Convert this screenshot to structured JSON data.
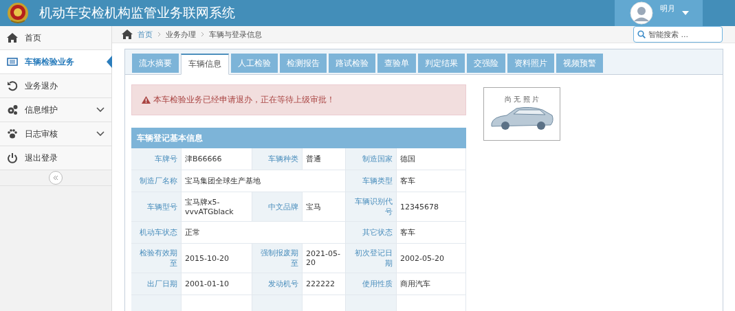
{
  "header": {
    "title": "机动车安检机构监管业务联网系统",
    "user": "明月"
  },
  "sidebar": {
    "items": [
      {
        "label": "首页",
        "selected": false,
        "expandable": false
      },
      {
        "label": "车辆检验业务",
        "selected": true,
        "expandable": false
      },
      {
        "label": "业务退办",
        "selected": false,
        "expandable": false
      },
      {
        "label": "信息维护",
        "selected": false,
        "expandable": true
      },
      {
        "label": "日志审核",
        "selected": false,
        "expandable": true
      },
      {
        "label": "退出登录",
        "selected": false,
        "expandable": false
      }
    ]
  },
  "breadcrumb": [
    "首页",
    "业务办理",
    "车辆与登录信息"
  ],
  "search": {
    "placeholder": "智能搜索 ..."
  },
  "tabs": [
    {
      "label": "流水摘要",
      "selected": false
    },
    {
      "label": "车辆信息",
      "selected": true
    },
    {
      "label": "人工检验",
      "selected": false
    },
    {
      "label": "检测报告",
      "selected": false
    },
    {
      "label": "路试检验",
      "selected": false
    },
    {
      "label": "查验单",
      "selected": false
    },
    {
      "label": "判定结果",
      "selected": false
    },
    {
      "label": "交强险",
      "selected": false
    },
    {
      "label": "资料照片",
      "selected": false
    },
    {
      "label": "视频预警",
      "selected": false
    }
  ],
  "alert": "本车检验业务已经申请退办，正在等待上级审批！",
  "photo": {
    "caption": "尚 无 照 片"
  },
  "table": {
    "title": "车辆登记基本信息",
    "rows": [
      [
        {
          "label": "车牌号",
          "value": "津B66666",
          "wide": false
        },
        {
          "label": "车辆种类",
          "value": "普通",
          "wide": false
        },
        {
          "label": "制造国家",
          "value": "德国",
          "wide": false
        }
      ],
      [
        {
          "label": "制造厂名称",
          "value": "宝马集团全球生产基地",
          "wide": true
        },
        {
          "label": "车辆类型",
          "value": "客车",
          "wide": false
        }
      ],
      [
        {
          "label": "车辆型号",
          "value": "宝马牌x5-vvvATGblack",
          "wide": false
        },
        {
          "label": "中文品牌",
          "value": "宝马",
          "wide": false
        },
        {
          "label": "车辆识别代号",
          "value": "12345678",
          "wide": false
        }
      ],
      [
        {
          "label": "机动车状态",
          "value": "正常",
          "wide": true
        },
        {
          "label": "其它状态",
          "value": "客车",
          "wide": false
        }
      ],
      [
        {
          "label": "检验有效期至",
          "value": "2015-10-20",
          "wide": false
        },
        {
          "label": "强制报废期至",
          "value": "2021-05-20",
          "wide": false
        },
        {
          "label": "初次登记日期",
          "value": "2002-05-20",
          "wide": false
        }
      ],
      [
        {
          "label": "出厂日期",
          "value": "2001-01-10",
          "wide": false
        },
        {
          "label": "发动机号",
          "value": "222222",
          "wide": false
        },
        {
          "label": "使用性质",
          "value": "商用汽车",
          "wide": false
        }
      ]
    ]
  }
}
